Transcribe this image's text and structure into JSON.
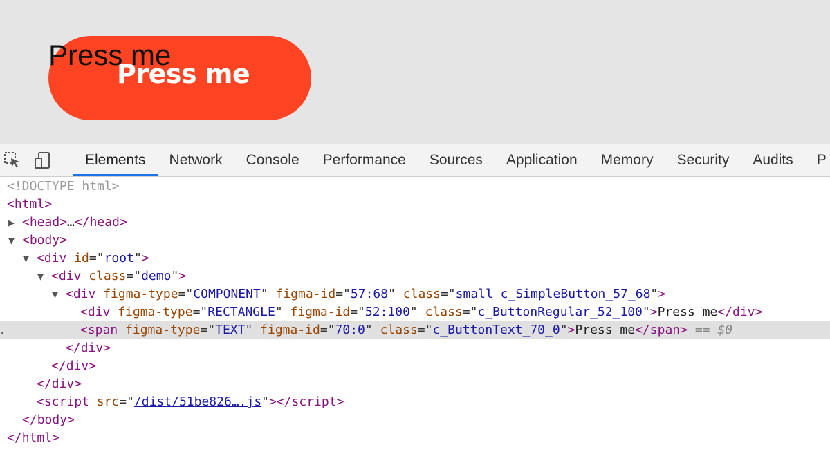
{
  "preview": {
    "button_label": "Press me",
    "overlay_label": "Press me",
    "button_color": "#fe4423",
    "background_color": "#e5e5e5"
  },
  "devtools": {
    "icons": {
      "inspect": "inspect-element-icon",
      "device": "device-toggle-icon"
    },
    "tabs": [
      {
        "label": "Elements",
        "active": true
      },
      {
        "label": "Network"
      },
      {
        "label": "Console"
      },
      {
        "label": "Performance"
      },
      {
        "label": "Sources"
      },
      {
        "label": "Application"
      },
      {
        "label": "Memory"
      },
      {
        "label": "Security"
      },
      {
        "label": "Audits"
      },
      {
        "label": "P"
      }
    ],
    "accent_color": "#1a73e8",
    "dom": {
      "doctype": "<!DOCTYPE html>",
      "html_open": "html",
      "head_tag": "head",
      "head_ellipsis": "…",
      "body_tag": "body",
      "div": "div",
      "span": "span",
      "script": "script",
      "root": {
        "attr": "id",
        "value": "root"
      },
      "demo": {
        "attr": "class",
        "value": "demo"
      },
      "component": {
        "attr1": "figma-type",
        "val1": "COMPONENT",
        "attr2": "figma-id",
        "val2": "57:68",
        "attr3": "class",
        "val3": "small c_SimpleButton_57_68"
      },
      "rectangle": {
        "attr1": "figma-type",
        "val1": "RECTANGLE",
        "attr2": "figma-id",
        "val2": "52:100",
        "attr3": "class",
        "val3": "c_ButtonRegular_52_100",
        "text": "Press me"
      },
      "text_span": {
        "attr1": "figma-type",
        "val1": "TEXT",
        "attr2": "figma-id",
        "val2": "70:0",
        "attr3": "class",
        "val3": "c_ButtonText_70_0",
        "text": "Press me",
        "selection_marker": "== $0"
      },
      "script_src": {
        "attr": "src",
        "value": "/dist/51be826….js"
      }
    }
  }
}
